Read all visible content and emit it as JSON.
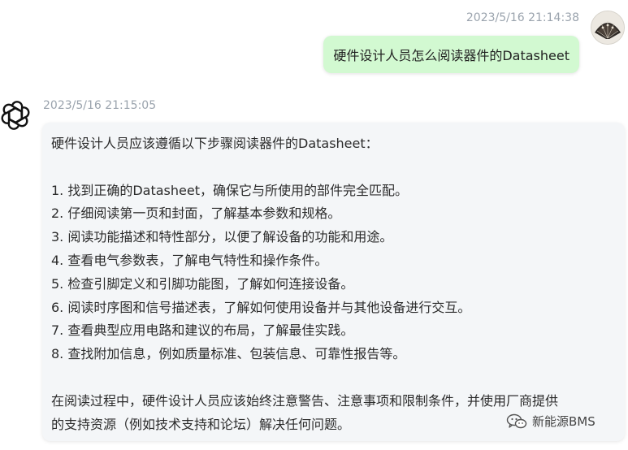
{
  "user_message": {
    "timestamp": "2023/5/16 21:14:38",
    "text": "硬件设计人员怎么阅读器件的Datasheet"
  },
  "bot_message": {
    "timestamp": "2023/5/16 21:15:05",
    "intro": "硬件设计人员应该遵循以下步骤阅读器件的Datasheet：",
    "steps": [
      "1. 找到正确的Datasheet，确保它与所使用的部件完全匹配。",
      "2. 仔细阅读第一页和封面，了解基本参数和规格。",
      "3. 阅读功能描述和特性部分，以便了解设备的功能和用途。",
      "4. 查看电气参数表，了解电气特性和操作条件。",
      "5. 检查引脚定义和引脚功能图，了解如何连接设备。",
      "6. 阅读时序图和信号描述表，了解如何使用设备并与其他设备进行交互。",
      "7. 查看典型应用电路和建议的布局，了解最佳实践。",
      "8. 查找附加信息，例如质量标准、包装信息、可靠性报告等。"
    ],
    "conclusion_line1": "在阅读过程中，硬件设计人员应该始终注意警告、注意事项和限制条件，并使用厂商提供",
    "conclusion_line2": "的支持资源（例如技术支持和论坛）解决任何问题。"
  },
  "watermark": {
    "icon": "wechat-icon",
    "text": "新能源BMS"
  },
  "colors": {
    "user_bubble": "#d2f9d1",
    "bot_bubble": "#f4f6f8",
    "timestamp": "#9aa3ad"
  }
}
